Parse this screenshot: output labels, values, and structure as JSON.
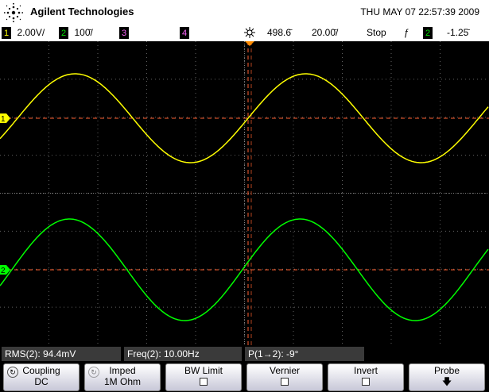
{
  "header": {
    "brand": "Agilent Technologies",
    "datetime": "THU MAY 07 22:57:39 2009"
  },
  "status": {
    "ch1_num": "1",
    "ch1_scale": "2.00V/",
    "ch2_num": "2",
    "ch2_scale": "100̄/",
    "ch3_num": "3",
    "ch4_num": "4",
    "time_pos": "498.6̄",
    "time_scale": "20.00̄/",
    "run_state": "Stop",
    "trigger_slope": "ƒ",
    "trig_ch": "2",
    "trig_level": "-1.25̄"
  },
  "colors": {
    "ch1": "#ffff00",
    "ch2": "#00ff00",
    "grid": "#606060",
    "cursor": "#ff6030"
  },
  "waveforms": {
    "ch1_cycles": 2.1,
    "ch2_phase_deg": -9
  },
  "measurements": [
    {
      "name": "RMS",
      "ch": "2",
      "value": ": 94.4mV"
    },
    {
      "name": "Freq",
      "ch": "2",
      "value": ": 10.00Hz"
    },
    {
      "name": "P",
      "ch": "1",
      "value": "): -9°"
    }
  ],
  "meas_labels": {
    "rms": "RMS(2): 94.4mV",
    "freq": "Freq(2): 10.00Hz",
    "phase": "P(1→2): -9°"
  },
  "softkeys": [
    {
      "label": "Coupling",
      "value": "DC"
    },
    {
      "label": "Imped",
      "value": "1M Ohm"
    },
    {
      "label": "BW Limit",
      "value": ""
    },
    {
      "label": "Vernier",
      "value": ""
    },
    {
      "label": "Invert",
      "value": ""
    },
    {
      "label": "Probe",
      "value": ""
    }
  ],
  "marker_labels": {
    "ch1": "1",
    "ch2": "2"
  }
}
